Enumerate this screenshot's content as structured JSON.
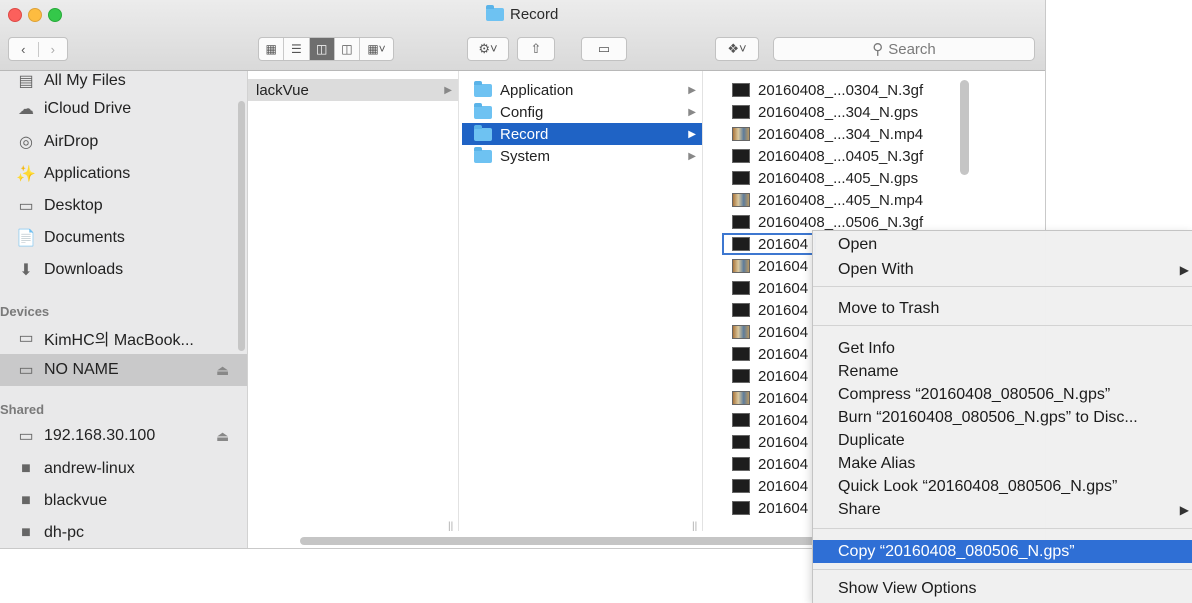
{
  "window": {
    "title": "Record",
    "search_placeholder": "Search"
  },
  "toolbar": {
    "icons": [
      "back-icon",
      "forward-icon",
      "icon-view-icon",
      "list-view-icon",
      "column-view-icon",
      "coverflow-view-icon",
      "arrange-icon",
      "action-gear-icon",
      "share-icon",
      "tag-icon",
      "dropbox-icon",
      "search-icon"
    ]
  },
  "sidebar": {
    "favorites": [
      {
        "label": "All My Files",
        "icon": "all-files-icon"
      },
      {
        "label": "iCloud Drive",
        "icon": "cloud-icon"
      },
      {
        "label": "AirDrop",
        "icon": "airdrop-icon"
      },
      {
        "label": "Applications",
        "icon": "applications-icon"
      },
      {
        "label": "Desktop",
        "icon": "desktop-icon"
      },
      {
        "label": "Documents",
        "icon": "documents-icon"
      },
      {
        "label": "Downloads",
        "icon": "downloads-icon"
      }
    ],
    "devices_heading": "Devices",
    "devices": [
      {
        "label": "KimHC의 MacBook...",
        "icon": "laptop-icon"
      },
      {
        "label": "NO NAME",
        "icon": "drive-icon",
        "eject": "⏏"
      }
    ],
    "shared_heading": "Shared",
    "shared": [
      {
        "label": "192.168.30.100",
        "icon": "server-icon",
        "eject": "⏏"
      },
      {
        "label": "andrew-linux",
        "icon": "computer-icon"
      },
      {
        "label": "blackvue",
        "icon": "computer-icon"
      },
      {
        "label": "dh-pc",
        "icon": "computer-icon"
      }
    ]
  },
  "column1": {
    "items": [
      {
        "label": "lackVue"
      }
    ]
  },
  "column2": {
    "items": [
      {
        "label": "Application"
      },
      {
        "label": "Config"
      },
      {
        "label": "Record"
      },
      {
        "label": "System"
      }
    ]
  },
  "column3": {
    "items": [
      {
        "label": "20160408_...0304_N.3gf",
        "type": "doc"
      },
      {
        "label": "20160408_...304_N.gps",
        "type": "doc"
      },
      {
        "label": "20160408_...304_N.mp4",
        "type": "mp4"
      },
      {
        "label": "20160408_...0405_N.3gf",
        "type": "doc"
      },
      {
        "label": "20160408_...405_N.gps",
        "type": "doc"
      },
      {
        "label": "20160408_...405_N.mp4",
        "type": "mp4"
      },
      {
        "label": "20160408_...0506_N.3gf",
        "type": "doc"
      },
      {
        "label": "201604",
        "type": "doc"
      },
      {
        "label": "201604",
        "type": "mp4"
      },
      {
        "label": "201604",
        "type": "doc"
      },
      {
        "label": "201604",
        "type": "doc"
      },
      {
        "label": "201604",
        "type": "mp4"
      },
      {
        "label": "201604",
        "type": "doc"
      },
      {
        "label": "201604",
        "type": "doc"
      },
      {
        "label": "201604",
        "type": "mp4"
      },
      {
        "label": "201604",
        "type": "doc"
      },
      {
        "label": "201604",
        "type": "doc"
      },
      {
        "label": "201604",
        "type": "doc"
      },
      {
        "label": "201604",
        "type": "doc"
      },
      {
        "label": "201604",
        "type": "doc"
      }
    ]
  },
  "context_menu": {
    "open": "Open",
    "open_with": "Open With",
    "move_to_trash": "Move to Trash",
    "get_info": "Get Info",
    "rename": "Rename",
    "compress": "Compress “20160408_080506_N.gps”",
    "burn": "Burn “20160408_080506_N.gps” to Disc...",
    "duplicate": "Duplicate",
    "make_alias": "Make Alias",
    "quick_look": "Quick Look “20160408_080506_N.gps”",
    "share": "Share",
    "copy": "Copy “20160408_080506_N.gps”",
    "show_view_options": "Show View Options"
  },
  "colors": {
    "selection_blue": "#1f63c5",
    "menu_highlight": "#2f6fd5"
  }
}
